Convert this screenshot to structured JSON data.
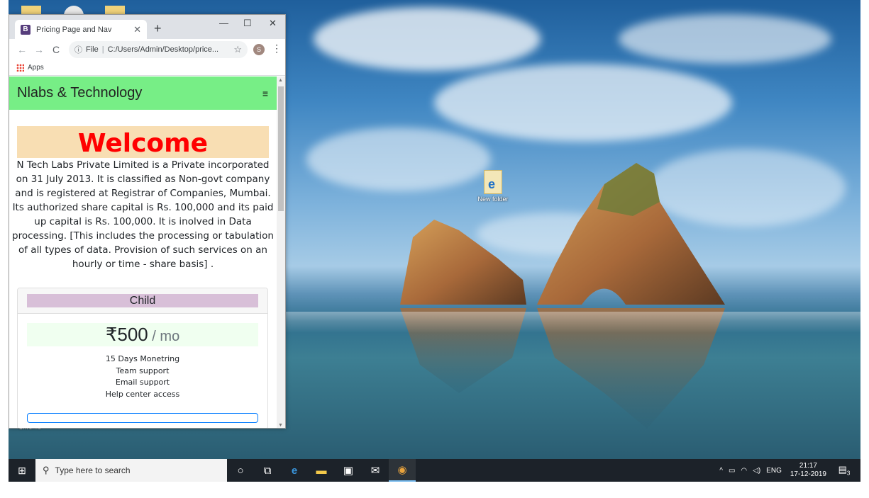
{
  "browser": {
    "tab_title": "Pricing Page and Nav",
    "favicon_letter": "B",
    "tab_close": "✕",
    "new_tab": "+",
    "url_scheme": "File",
    "url": "C:/Users/Admin/Desktop/price...",
    "profile_initial": "S",
    "bookmarks_apps": "Apps",
    "icons": [
      "back-arrow-icon",
      "forward-arrow-icon",
      "reload-icon",
      "info-icon",
      "star-icon",
      "kebab-menu-icon"
    ]
  },
  "page": {
    "brand": "Nlabs & Technology",
    "toggler": "≡",
    "welcome": "Welcome",
    "about": "N Tech Labs Private Limited is a Private incorporated on 31 July 2013. It is classified as Non-govt company and is registered at Registrar of Companies, Mumbai. Its authorized share capital is Rs. 100,000 and its paid up capital is Rs. 100,000. It is inolved in Data processing. [This includes the processing or tabulation of all types of data. Provision of such services on an hourly or time - share basis] .",
    "card": {
      "header": "Child",
      "price": "₹500",
      "period": " / mo",
      "features": [
        "15 Days Monetring",
        "Team support",
        "Email support",
        "Help center access"
      ]
    },
    "colors": {
      "navbar": "#77ee86",
      "welcome_bg": "#f8deb3",
      "welcome_text": "#ff0000",
      "card_header": "#d8bfd8",
      "price_bg": "#f0fff0"
    }
  },
  "desktop": {
    "folder_label": "New folder",
    "chrome_label": "Chrome"
  },
  "taskbar": {
    "search_placeholder": "Type here to search",
    "language": "ENG",
    "time": "21:17",
    "date": "17-12-2019",
    "notification_count": "3"
  }
}
